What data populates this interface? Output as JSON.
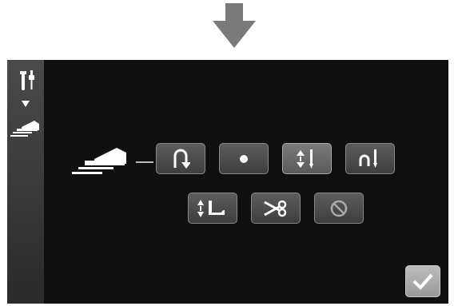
{
  "screen": {
    "title": "",
    "accent_color": "#ffffff"
  },
  "sidebar": {
    "items": [
      {
        "icon": "settings-wrench-screwdriver-icon"
      },
      {
        "icon": "arrow-down-small-icon"
      },
      {
        "icon": "foot-pedal-icon"
      }
    ]
  },
  "pedal_row": {
    "icon": "foot-pedal-large-icon"
  },
  "buttons": [
    {
      "icon": "reverse-stitch-icon",
      "selected": false
    },
    {
      "icon": "single-stitch-icon",
      "selected": false
    },
    {
      "icon": "needle-up-down-icon",
      "selected": true
    },
    {
      "icon": "needle-up-icon",
      "selected": false
    },
    {
      "icon": "presser-foot-up-down-icon",
      "selected": false
    },
    {
      "icon": "thread-cut-scissors-icon",
      "selected": false
    },
    {
      "icon": "none-prohibited-icon",
      "selected": false
    }
  ],
  "ok_button": {
    "icon": "checkmark-icon"
  }
}
